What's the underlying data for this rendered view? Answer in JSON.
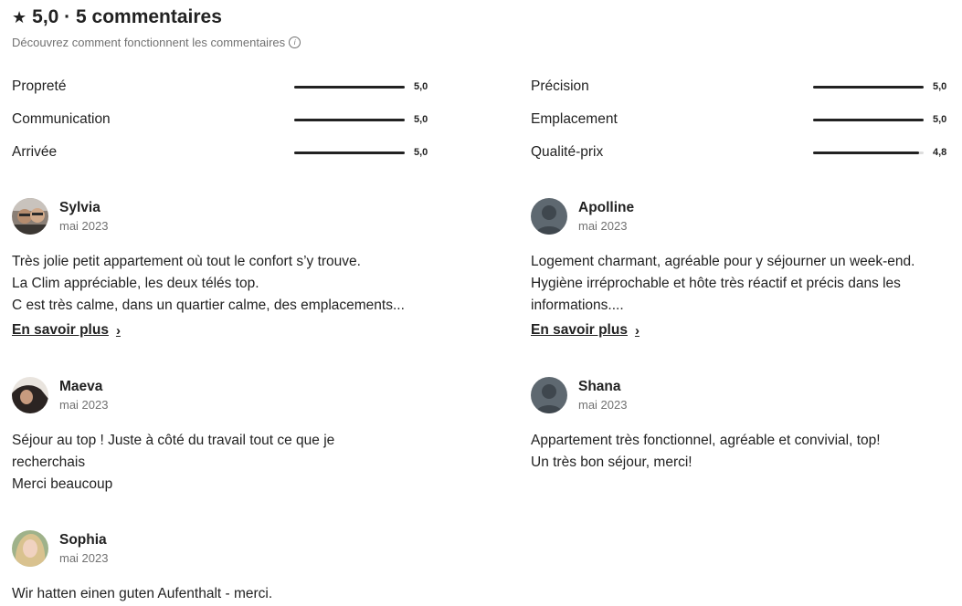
{
  "header": {
    "title": "5,0 · 5 commentaires",
    "star_icon": "★",
    "subtitle": "Découvrez comment fonctionnent les commentaires",
    "info_icon": "i"
  },
  "ratings": [
    {
      "label": "Propreté",
      "value": "5,0",
      "fraction": 1.0
    },
    {
      "label": "Communication",
      "value": "5,0",
      "fraction": 1.0
    },
    {
      "label": "Arrivée",
      "value": "5,0",
      "fraction": 1.0
    },
    {
      "label": "Précision",
      "value": "5,0",
      "fraction": 1.0
    },
    {
      "label": "Emplacement",
      "value": "5,0",
      "fraction": 1.0
    },
    {
      "label": "Qualité-prix",
      "value": "4,8",
      "fraction": 0.96
    }
  ],
  "reviews": [
    {
      "name": "Sylvia",
      "date": "mai 2023",
      "avatar": "photo-avatar",
      "lines": [
        "Très jolie petit appartement où tout le confort s’y trouve.",
        "La Clim appréciable, les deux télés top.",
        "C est très calme, dans un quartier calme, des emplacements..."
      ],
      "read_more": "En savoir plus"
    },
    {
      "name": "Apolline",
      "date": "mai 2023",
      "avatar": "default-avatar",
      "lines": [
        "Logement charmant, agréable pour y séjourner un week-end.",
        "Hygiène irréprochable et hôte très réactif et précis dans les",
        "informations...."
      ],
      "read_more": "En savoir plus"
    },
    {
      "name": "Maeva",
      "date": "mai 2023",
      "avatar": "photo-avatar",
      "lines": [
        "Séjour au top ! Juste à côté du travail tout ce que je",
        "recherchais",
        "Merci beaucoup"
      ]
    },
    {
      "name": "Shana",
      "date": "mai 2023",
      "avatar": "default-avatar",
      "lines": [
        "Appartement très fonctionnel, agréable et convivial, top!",
        "Un très bon séjour, merci!"
      ]
    },
    {
      "name": "Sophia",
      "date": "mai 2023",
      "avatar": "photo-avatar",
      "lines": [
        "Wir hatten einen guten Aufenthalt - merci."
      ]
    }
  ],
  "colors": {
    "text": "#222222",
    "muted": "#717171",
    "bar_track": "#dddddd",
    "default_avatar": "#5e6870"
  }
}
